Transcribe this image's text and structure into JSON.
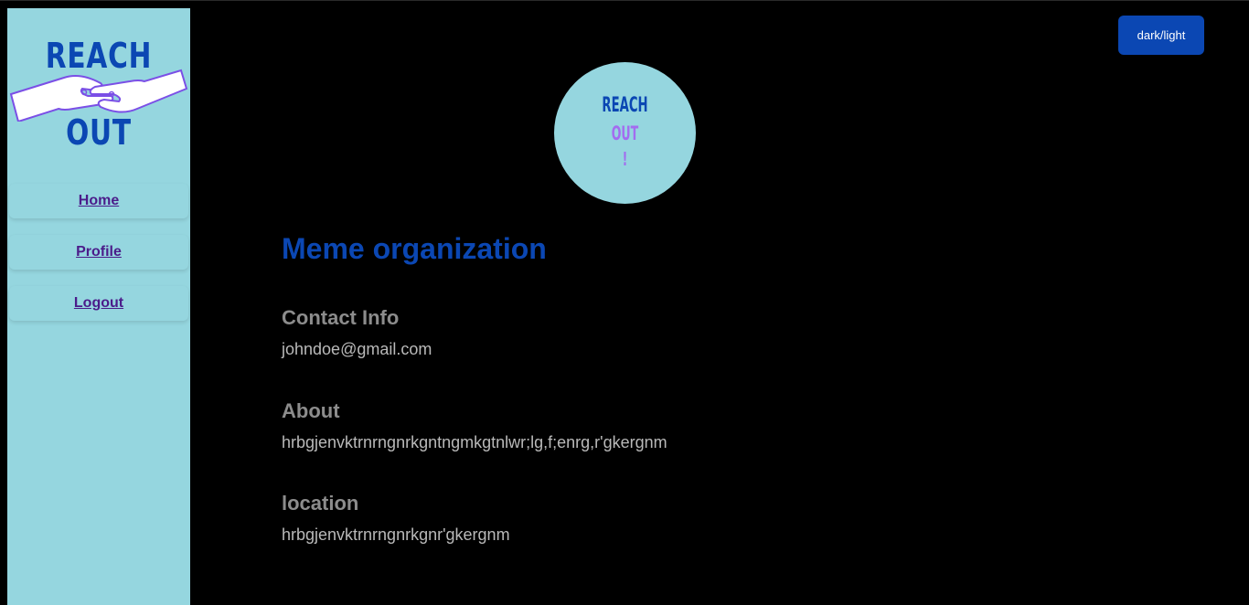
{
  "sidebar": {
    "logo": {
      "top_text": "REACH",
      "bottom_text": "OUT",
      "icon": "hands-reaching-icon"
    },
    "items": [
      {
        "label": "Home"
      },
      {
        "label": "Profile"
      },
      {
        "label": "Logout"
      }
    ]
  },
  "header": {
    "theme_toggle_label": "dark/light"
  },
  "avatar": {
    "line1": "REACH",
    "line2": "OUT",
    "line3": "!"
  },
  "profile": {
    "org_name": "Meme organization",
    "sections": [
      {
        "heading": "Contact Info",
        "value": "johndoe@gmail.com"
      },
      {
        "heading": "About",
        "value": "hrbgjenvktrnrngnrkgntngmkgtnlwr;lg,f;enrg,r'gkergnm"
      },
      {
        "heading": "location",
        "value": "hrbgjenvktrnrngnrkgnr'gkergnm"
      }
    ]
  },
  "colors": {
    "sidebar_bg": "#95d6df",
    "accent_blue": "#0b47b3",
    "accent_purple": "#a36cf0",
    "nav_link": "#4b1c8a",
    "page_bg": "#000000"
  }
}
